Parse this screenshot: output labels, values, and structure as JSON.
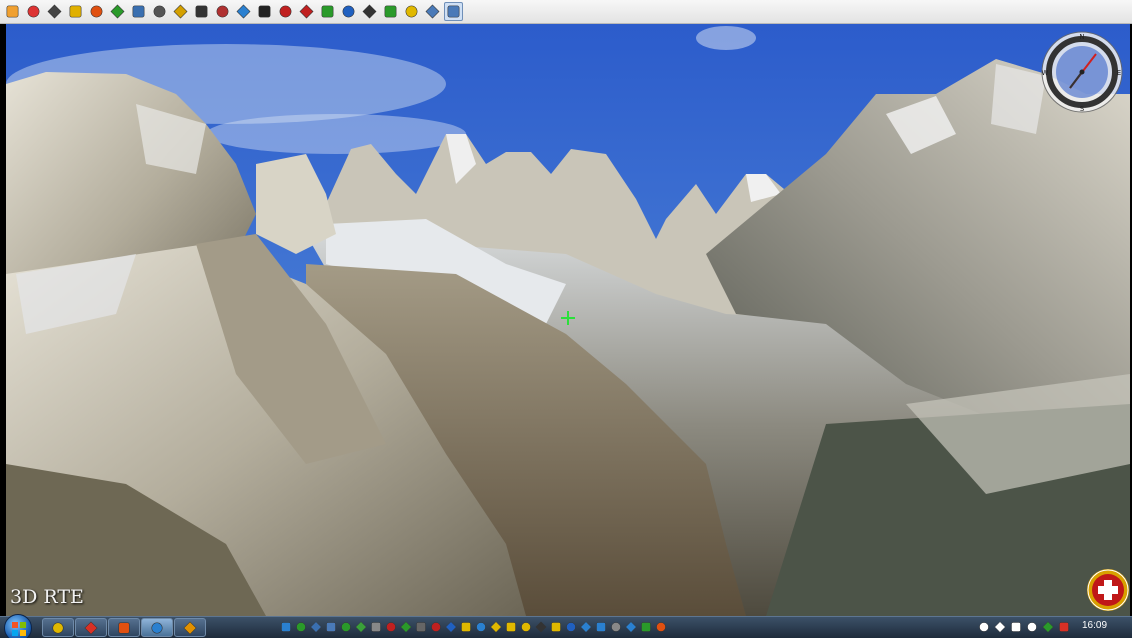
{
  "toolbar": {
    "buttons": [
      {
        "icon": "orange-square-icon",
        "color": "#f0a030"
      },
      {
        "icon": "home-icon",
        "color": "#d33"
      },
      {
        "icon": "grid-icon",
        "color": "#444"
      },
      {
        "icon": "lock-icon",
        "color": "#e0b000"
      },
      {
        "icon": "pencil-icon",
        "color": "#e05010"
      },
      {
        "icon": "walker-icon",
        "color": "#2a9a2a"
      },
      {
        "icon": "diamond-icon",
        "color": "#3a6fb0"
      },
      {
        "icon": "binoculars-icon",
        "color": "#555"
      },
      {
        "icon": "balloon-icon",
        "color": "#d4a000"
      },
      {
        "icon": "eye-icon",
        "color": "#333"
      },
      {
        "icon": "antenna-icon",
        "color": "#b03030"
      },
      {
        "icon": "wave-icon",
        "color": "#2a80d0"
      },
      {
        "icon": "grid-dots-icon",
        "color": "#222"
      },
      {
        "icon": "flag-icon",
        "color": "#c02020"
      },
      {
        "icon": "pdf-icon",
        "color": "#c02020"
      },
      {
        "icon": "map-icon",
        "color": "#2a9a2a"
      },
      {
        "icon": "globe-icon",
        "color": "#2060c0"
      },
      {
        "icon": "film-icon",
        "color": "#333"
      },
      {
        "icon": "world-icon",
        "color": "#2a9a2a"
      },
      {
        "icon": "folder-icon",
        "color": "#e0b800"
      },
      {
        "icon": "settings-icon",
        "color": "#4a7ab8"
      },
      {
        "icon": "monitor-icon",
        "color": "#4a7ab8"
      }
    ],
    "active_index": 21
  },
  "viewport": {
    "watermark": "3D RTE",
    "compass": {
      "marks": [
        "N",
        "S",
        "E",
        "W"
      ]
    },
    "sky_color": "#2a58c8",
    "rock_color": "#b7b2a5",
    "snow_color": "#e9ecef"
  },
  "taskbar": {
    "apps": [
      {
        "icon": "explorer-icon",
        "color": "#e0b800"
      },
      {
        "icon": "chrome-icon",
        "color": "#d93025"
      },
      {
        "icon": "media-icon",
        "color": "#e05010"
      },
      {
        "icon": "ie-icon",
        "color": "#2a80d0"
      },
      {
        "icon": "player-icon",
        "color": "#e09000"
      }
    ],
    "active_app": 3,
    "quick_launch_colors": [
      "#2a80d0",
      "#2a9a2a",
      "#3a6fb0",
      "#4a7ab8",
      "#2a9a2a",
      "#3aa03a",
      "#888",
      "#c02020",
      "#2a9a2a",
      "#666",
      "#c02020",
      "#2060c0",
      "#e0b800",
      "#2a80d0",
      "#e0b800",
      "#e0b800",
      "#e0b800",
      "#333",
      "#e0b800",
      "#2060c0",
      "#2a80d0",
      "#2a80d0",
      "#888",
      "#2a80d0",
      "#2a9a2a",
      "#e05010"
    ],
    "tray_colors": [
      "#ffffff",
      "#ffffff",
      "#ffffff",
      "#ffffff",
      "#2a9a2a",
      "#d93025"
    ],
    "clock": "16:09"
  }
}
